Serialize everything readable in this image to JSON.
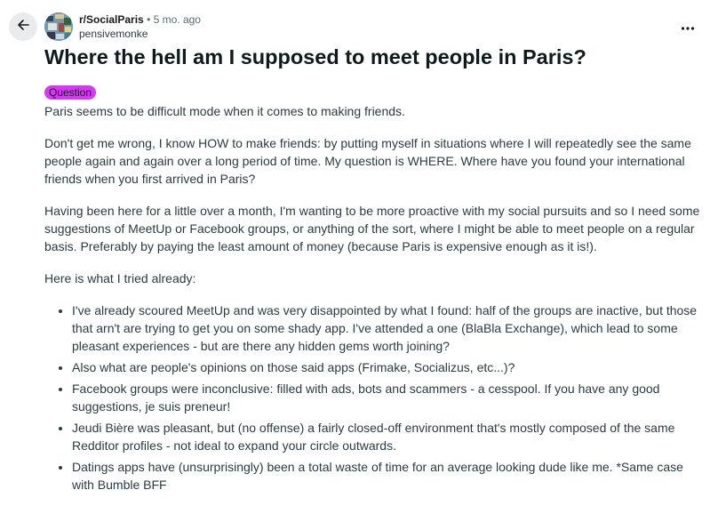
{
  "header": {
    "subreddit": "r/SocialParis",
    "separator": "•",
    "age": "5 mo. ago",
    "username": "pensivemonke"
  },
  "icons": {
    "back": "arrow-left-icon",
    "more": "more-horizontal-icon"
  },
  "post": {
    "title": "Where the hell am I supposed to meet people in Paris?",
    "flair": "Question",
    "flair_color": "#d43af5",
    "paragraphs": [
      "Paris seems to be difficult mode when it comes to making friends.",
      "Don't get me wrong, I know HOW to make friends: by putting myself in situations where I will repeatedly see the same people again and again over a long period of time. My question is WHERE. Where have you found your international friends when you first arrived in Paris?",
      "Having been here for a little over a month, I'm wanting to be more proactive with my social pursuits and so I need some suggestions of MeetUp or Facebook groups, or anything of the sort, where I might be able to meet people on a regular basis. Preferably by paying the least amount of money (because Paris is expensive enough as it is!).",
      "Here is what I tried already:"
    ],
    "bullets": [
      "I've already scoured MeetUp and was very disappointed by what I found: half of the groups are inactive, but those that arn't are trying to get you on some shady app. I've attended a one (BlaBla Exchange), which lead to some pleasant experiences - but are there any hidden gems worth joining?",
      "Also what are people's opinions on those said apps (Frimake, Socializus, etc...)?",
      "Facebook groups were inconclusive: filled with ads, bots and scammers - a cesspool. If you have any good suggestions, je suis preneur!",
      "Jeudi Bière was pleasant, but (no offense) a fairly closed-off environment that's mostly composed of the same Redditor profiles - not ideal to expand your circle outwards.",
      "Datings apps have (unsurprisingly) been a total waste of time for an average looking dude like me. *Same case with Bumble BFF"
    ]
  }
}
